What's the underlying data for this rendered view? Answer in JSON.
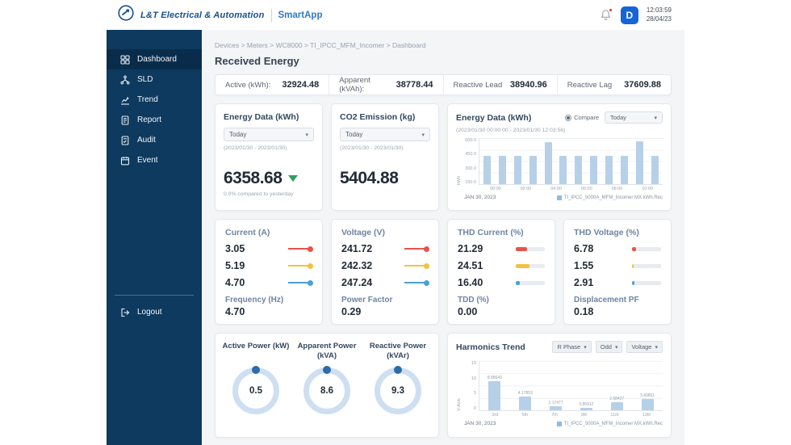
{
  "header": {
    "brand": "L&T Electrical & Automation",
    "app_name": "SmartApp",
    "time": "12:03:59",
    "date": "28/04/23",
    "avatar_initial": "D"
  },
  "sidebar": {
    "items": [
      {
        "label": "Dashboard",
        "icon": "dashboard-icon",
        "active": true
      },
      {
        "label": "SLD",
        "icon": "sld-icon",
        "active": false
      },
      {
        "label": "Trend",
        "icon": "trend-icon",
        "active": false
      },
      {
        "label": "Report",
        "icon": "report-icon",
        "active": false
      },
      {
        "label": "Audit",
        "icon": "audit-icon",
        "active": false
      },
      {
        "label": "Event",
        "icon": "event-icon",
        "active": false
      }
    ],
    "logout_label": "Logout"
  },
  "breadcrumb": "Devices > Meters > WC8000 > TI_IPCC_MFM_Incomer > Dashboard",
  "page_title": "Received Energy",
  "stats": [
    {
      "label": "Active (kWh):",
      "value": "32924.48"
    },
    {
      "label": "Apparent (kVAh):",
      "value": "38778.44"
    },
    {
      "label": "Reactive Lead",
      "value": "38940.96"
    },
    {
      "label": "Reactive Lag",
      "value": "37609.88"
    }
  ],
  "energy_card": {
    "title": "Energy Data (kWh)",
    "period": "Today",
    "range": "(2023/01/30 - 2023/01/30)",
    "value": "6358.68",
    "compare_note": "0.0% compared to yesterday"
  },
  "co2_card": {
    "title": "CO2 Emission (kg)",
    "period": "Today",
    "range": "(2023/01/30 - 2023/01/30)",
    "value": "5404.88"
  },
  "energy_chart_card": {
    "title": "Energy Data (kWh)",
    "compare_label": "Compare",
    "period": "Today",
    "range": "(2023/01/30 00:00:00 - 2023/01/30 12:03:56)"
  },
  "metric_cards": [
    {
      "title": "Current (A)",
      "style": "line",
      "metrics": [
        {
          "value": "3.05",
          "color": "#e5534b"
        },
        {
          "value": "5.19",
          "color": "#f2c240"
        },
        {
          "value": "4.70",
          "color": "#4aa0d9"
        }
      ],
      "sub_label": "Frequency (Hz)",
      "sub_value": "4.70"
    },
    {
      "title": "Voltage (V)",
      "style": "line",
      "metrics": [
        {
          "value": "241.72",
          "color": "#e5534b"
        },
        {
          "value": "242.32",
          "color": "#f2c240"
        },
        {
          "value": "247.24",
          "color": "#4aa0d9"
        }
      ],
      "sub_label": "Power Factor",
      "sub_value": "0.29"
    },
    {
      "title": "THD Current (%)",
      "style": "bar",
      "metrics": [
        {
          "value": "21.29",
          "color": "#e5534b",
          "pct": 40
        },
        {
          "value": "24.51",
          "color": "#f2c240",
          "pct": 47
        },
        {
          "value": "16.40",
          "color": "#4aa0d9",
          "pct": 14
        }
      ],
      "sub_label": "TDD (%)",
      "sub_value": "0.00"
    },
    {
      "title": "THD Voltage (%)",
      "style": "bar",
      "metrics": [
        {
          "value": "6.78",
          "color": "#e5534b",
          "pct": 13
        },
        {
          "value": "1.55",
          "color": "#f2c240",
          "pct": 6
        },
        {
          "value": "2.91",
          "color": "#4aa0d9",
          "pct": 9
        }
      ],
      "sub_label": "Displacement PF",
      "sub_value": "0.18"
    }
  ],
  "gauges_card": {
    "gauges": [
      {
        "title": "Active Power (kW)",
        "value": "0.5"
      },
      {
        "title": "Apparent Power (kVA)",
        "value": "8.6"
      },
      {
        "title": "Reactive Power (kVAr)",
        "value": "9.3"
      }
    ]
  },
  "harmonics_card": {
    "title": "Harmonics Trend",
    "filters": [
      "R Phase",
      "Odd",
      "Voltage"
    ]
  },
  "chart_data": [
    {
      "type": "bar",
      "title": "Energy Data (kWh)",
      "ylabel": "kWh",
      "ylim": [
        0,
        650
      ],
      "yticks": [
        "600.0",
        "450.0",
        "300.0",
        "150.0"
      ],
      "x": [
        "00:00",
        "01:00",
        "02:00",
        "03:00",
        "04:00",
        "05:00",
        "06:00",
        "07:00",
        "08:00",
        "09:00",
        "10:00",
        "11:00"
      ],
      "x_shown": [
        "00:00",
        "02:00",
        "04:00",
        "06:00",
        "08:00",
        "10:00"
      ],
      "values": [
        400,
        394,
        402,
        398,
        590,
        400,
        396,
        404,
        399,
        395,
        605,
        402
      ],
      "bar_color": "#b6d0e8",
      "grid": true,
      "legend_position": "bottom-right",
      "date_label": "JAN 30, 2023",
      "legend": "TI_IPCC_5000A_MFM_Incomer MX.kWh.Rec"
    },
    {
      "type": "bar",
      "title": "Harmonics Trend",
      "ylabel": "V-Axis",
      "ylim": [
        0,
        15
      ],
      "yticks": [
        "15",
        "10",
        "5",
        "0"
      ],
      "x": [
        "3rd",
        "5th",
        "7th",
        "9th",
        "11th",
        "13th"
      ],
      "values": [
        8.89,
        4.18,
        1.17,
        0.86,
        2.58,
        3.5
      ],
      "bar_labels": [
        "8.88643",
        "4.17853",
        "1.17477",
        "0.85912",
        "2.58427",
        "3.49851"
      ],
      "bar_color": "#b6d0e8",
      "grid": true,
      "legend_position": "bottom-right",
      "date_label": "JAN 30, 2023",
      "legend": "TI_IPCC_5000A_MFM_Incomer MX.kWh.Rec"
    }
  ]
}
